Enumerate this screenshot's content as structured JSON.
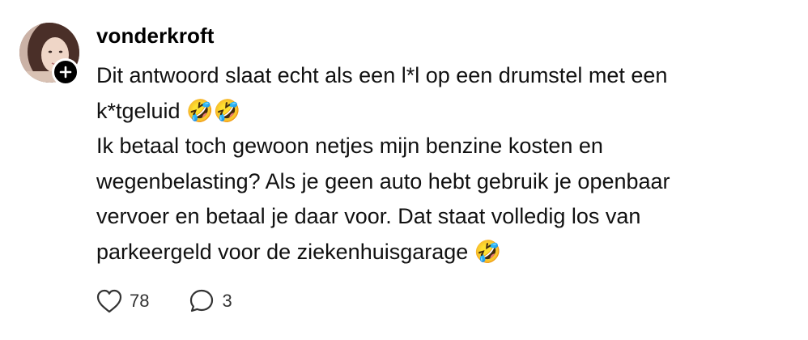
{
  "post": {
    "username": "vonderkroft",
    "lines": [
      "Dit antwoord slaat echt als een l*l op een drumstel met een",
      "k*tgeluid 🤣🤣",
      "Ik betaal toch gewoon netjes mijn benzine kosten en",
      "wegenbelasting? Als je geen auto hebt gebruik je openbaar",
      "vervoer en betaal je daar voor. Dat staat volledig los van",
      "parkeergeld voor de ziekenhuisgarage 🤣"
    ],
    "likes": "78",
    "replies": "3"
  },
  "icons": {
    "like": "heart-icon",
    "reply": "speech-bubble-icon",
    "follow": "plus-icon"
  },
  "colors": {
    "text": "#000000",
    "badge": "#000000"
  }
}
